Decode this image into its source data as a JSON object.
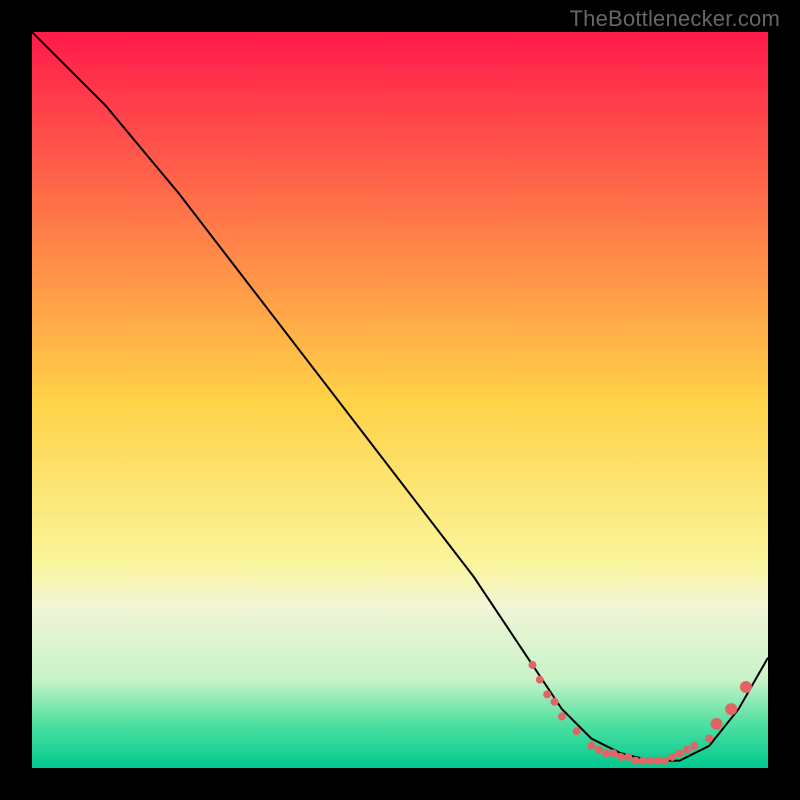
{
  "watermark": "TheBottlenecker.com",
  "chart_data": {
    "type": "line",
    "title": "",
    "xlabel": "",
    "ylabel": "",
    "xlim": [
      0,
      100
    ],
    "ylim": [
      0,
      100
    ],
    "grid": false,
    "background": {
      "type": "vertical-gradient",
      "stops": [
        {
          "offset": 0.0,
          "color": "#ff1a4b"
        },
        {
          "offset": 0.5,
          "color": "#ffd247"
        },
        {
          "offset": 0.72,
          "color": "#faf59a"
        },
        {
          "offset": 0.78,
          "color": "#f1f5d6"
        },
        {
          "offset": 0.88,
          "color": "#c9f3c8"
        },
        {
          "offset": 0.94,
          "color": "#4fe0a1"
        },
        {
          "offset": 1.0,
          "color": "#00c98f"
        }
      ]
    },
    "series": [
      {
        "name": "curve",
        "color": "#000000",
        "x": [
          0,
          6,
          10,
          20,
          30,
          40,
          50,
          60,
          68,
          72,
          76,
          80,
          84,
          88,
          92,
          96,
          100
        ],
        "y": [
          100,
          94,
          90,
          78,
          65,
          52,
          39,
          26,
          14,
          8,
          4,
          2,
          1,
          1,
          3,
          8,
          15
        ]
      }
    ],
    "markers": {
      "color": "#e06666",
      "radius_small": 4,
      "radius_large": 6,
      "points": [
        {
          "x": 68,
          "y": 14,
          "r": "small"
        },
        {
          "x": 69,
          "y": 12,
          "r": "small"
        },
        {
          "x": 70,
          "y": 10,
          "r": "small"
        },
        {
          "x": 71,
          "y": 9,
          "r": "small"
        },
        {
          "x": 72,
          "y": 7,
          "r": "small"
        },
        {
          "x": 74,
          "y": 5,
          "r": "small"
        },
        {
          "x": 76,
          "y": 3,
          "r": "small"
        },
        {
          "x": 77,
          "y": 2.5,
          "r": "small"
        },
        {
          "x": 78,
          "y": 2,
          "r": "small"
        },
        {
          "x": 79,
          "y": 2,
          "r": "small"
        },
        {
          "x": 80,
          "y": 1.5,
          "r": "small"
        },
        {
          "x": 81,
          "y": 1.5,
          "r": "small"
        },
        {
          "x": 82,
          "y": 1,
          "r": "small"
        },
        {
          "x": 83,
          "y": 1,
          "r": "small"
        },
        {
          "x": 84,
          "y": 1,
          "r": "small"
        },
        {
          "x": 85,
          "y": 1,
          "r": "small"
        },
        {
          "x": 86,
          "y": 1,
          "r": "small"
        },
        {
          "x": 87,
          "y": 1.5,
          "r": "small"
        },
        {
          "x": 88,
          "y": 2,
          "r": "small"
        },
        {
          "x": 89,
          "y": 2.5,
          "r": "small"
        },
        {
          "x": 90,
          "y": 3,
          "r": "small"
        },
        {
          "x": 92,
          "y": 4,
          "r": "small"
        },
        {
          "x": 93,
          "y": 6,
          "r": "large"
        },
        {
          "x": 95,
          "y": 8,
          "r": "large"
        },
        {
          "x": 97,
          "y": 11,
          "r": "large"
        }
      ]
    }
  }
}
